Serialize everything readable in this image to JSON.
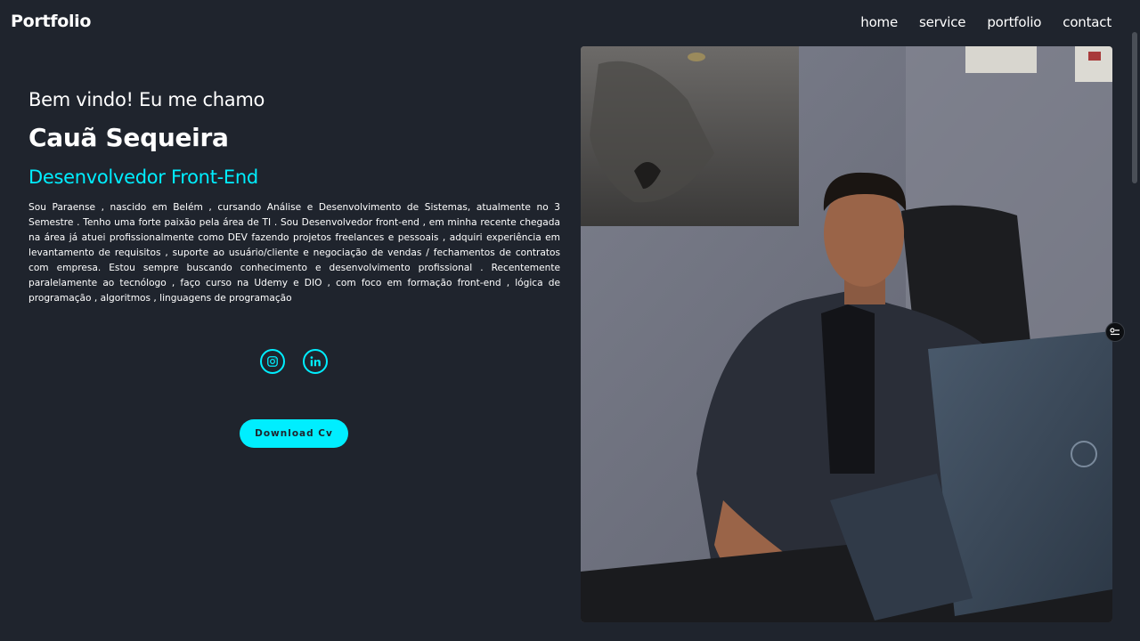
{
  "header": {
    "logo": "Portfolio",
    "nav": [
      "home",
      "service",
      "portfolio",
      "contact"
    ]
  },
  "home": {
    "greeting": "Bem vindo! Eu me chamo",
    "name": "Cauã Sequeira",
    "role": "Desenvolvedor Front-End",
    "bio": "Sou Paraense , nascido em Belém , cursando Análise e Desenvolvimento de Sistemas, atualmente no 3 Semestre . Tenho uma forte paixão pela área de TI . Sou Desenvolvedor front-end , em minha recente chegada na área já atuei profissionalmente como DEV fazendo projetos freelances e pessoais , adquiri experiência em levantamento de requisitos , suporte ao usuário/cliente e negociação de vendas / fechamentos de contratos com empresa. Estou sempre buscando conhecimento e desenvolvimento profissional . Recentemente paralelamente ao tecnólogo , faço curso na Udemy e DIO , com foco em formação front-end , lógica de programação , algoritmos , linguagens de programação",
    "social": [
      "instagram-icon",
      "linkedin-icon"
    ],
    "cv_button": "Download Cv"
  },
  "colors": {
    "background": "#1f242d",
    "accent": "#00eeff",
    "text": "#ffffff"
  }
}
